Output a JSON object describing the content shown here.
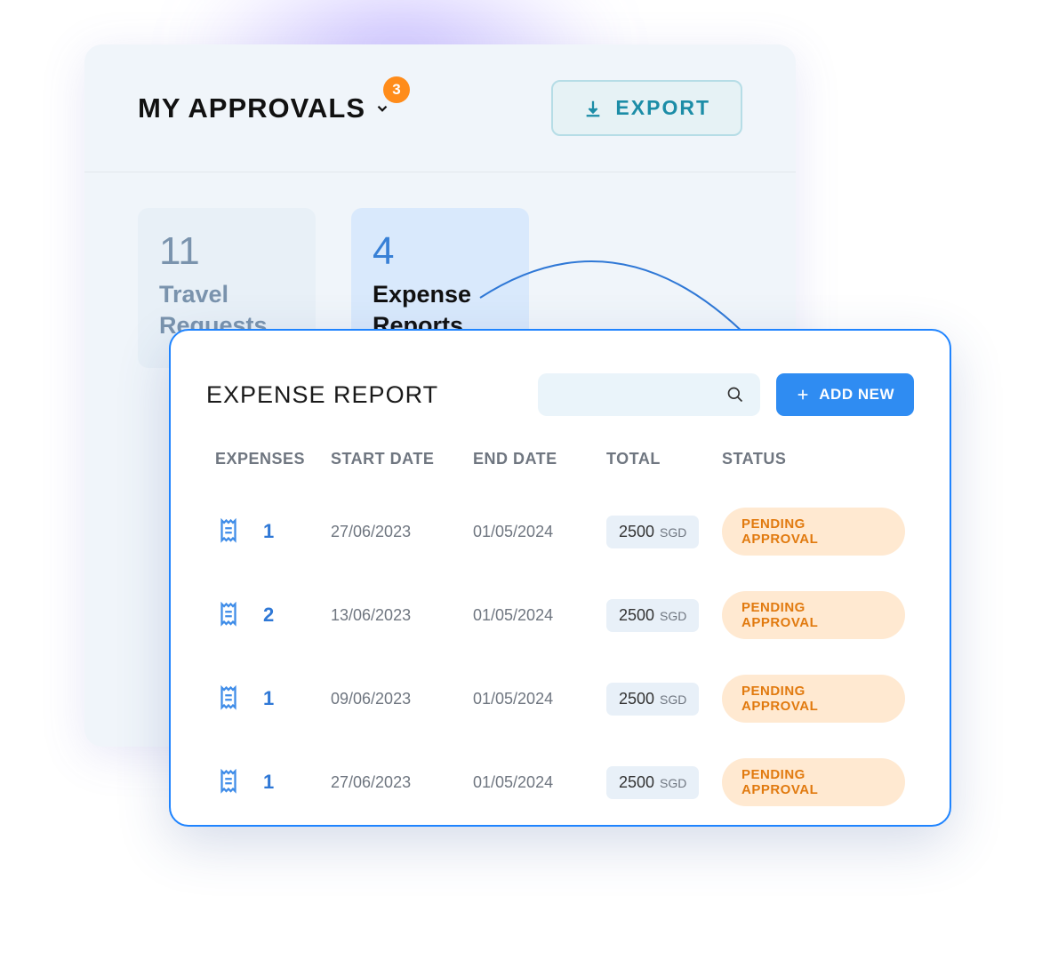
{
  "approvals": {
    "title": "MY APPROVALS",
    "badge_count": "3",
    "export_label": "EXPORT",
    "categories": [
      {
        "count": "11",
        "label": "Travel Requests"
      },
      {
        "count": "4",
        "label": "Expense Reports"
      }
    ]
  },
  "report": {
    "title": "EXPENSE REPORT",
    "add_new_label": "ADD NEW",
    "columns": {
      "expenses": "EXPENSES",
      "start_date": "START DATE",
      "end_date": "END DATE",
      "total": "TOTAL",
      "status": "STATUS"
    },
    "rows": [
      {
        "expenses": "1",
        "start_date": "27/06/2023",
        "end_date": "01/05/2024",
        "amount": "2500",
        "currency": "SGD",
        "status": "PENDING APPROVAL"
      },
      {
        "expenses": "2",
        "start_date": "13/06/2023",
        "end_date": "01/05/2024",
        "amount": "2500",
        "currency": "SGD",
        "status": "PENDING APPROVAL"
      },
      {
        "expenses": "1",
        "start_date": "09/06/2023",
        "end_date": "01/05/2024",
        "amount": "2500",
        "currency": "SGD",
        "status": "PENDING APPROVAL"
      },
      {
        "expenses": "1",
        "start_date": "27/06/2023",
        "end_date": "01/05/2024",
        "amount": "2500",
        "currency": "SGD",
        "status": "PENDING APPROVAL"
      }
    ]
  }
}
